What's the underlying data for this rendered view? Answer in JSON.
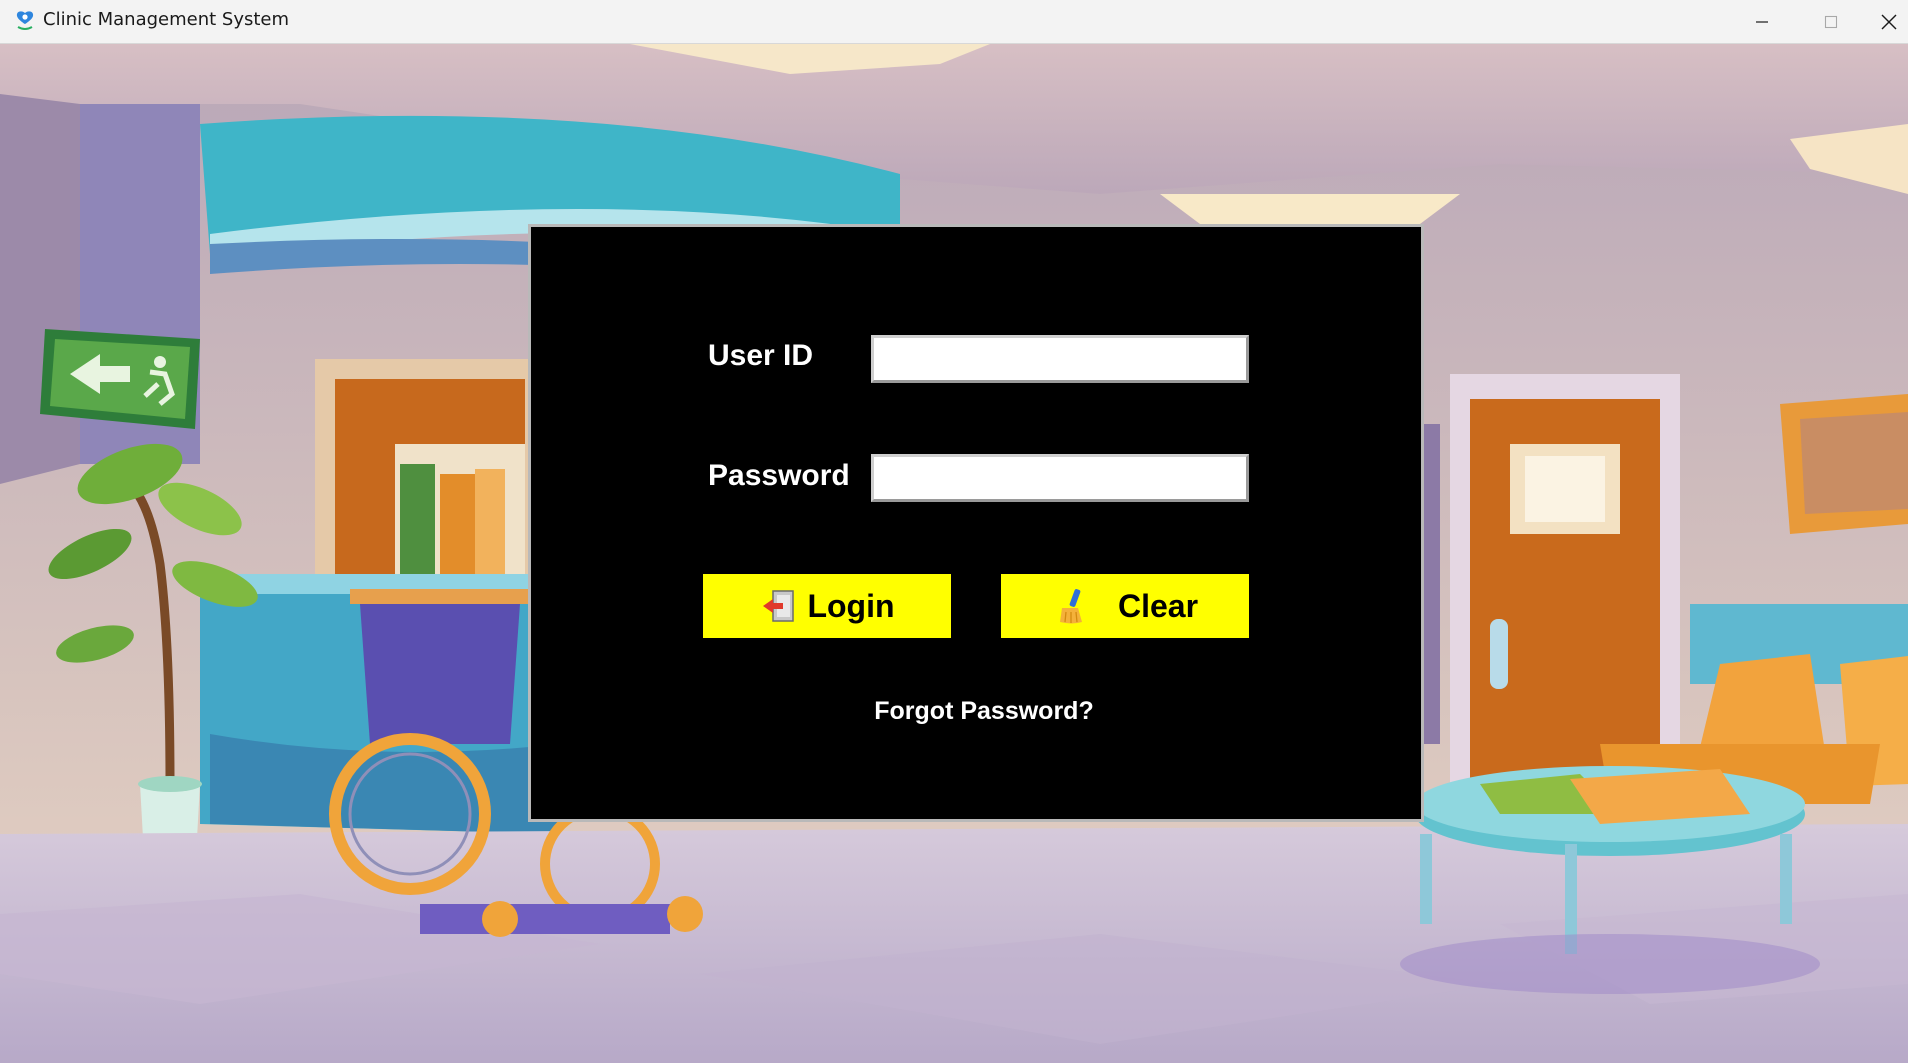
{
  "window": {
    "title": "Clinic Management System"
  },
  "login": {
    "user_id_label": "User ID",
    "user_id_value": "",
    "password_label": "Password",
    "password_value": "",
    "login_button_label": "Login",
    "clear_button_label": "Clear",
    "forgot_password_label": "Forgot Password?"
  },
  "colors": {
    "panel_background": "#000000",
    "button_background": "#ffff00",
    "label_text": "#ffffff"
  },
  "icons": {
    "app": "clinic-heart-icon",
    "login": "door-exit-icon",
    "clear": "broom-icon"
  }
}
